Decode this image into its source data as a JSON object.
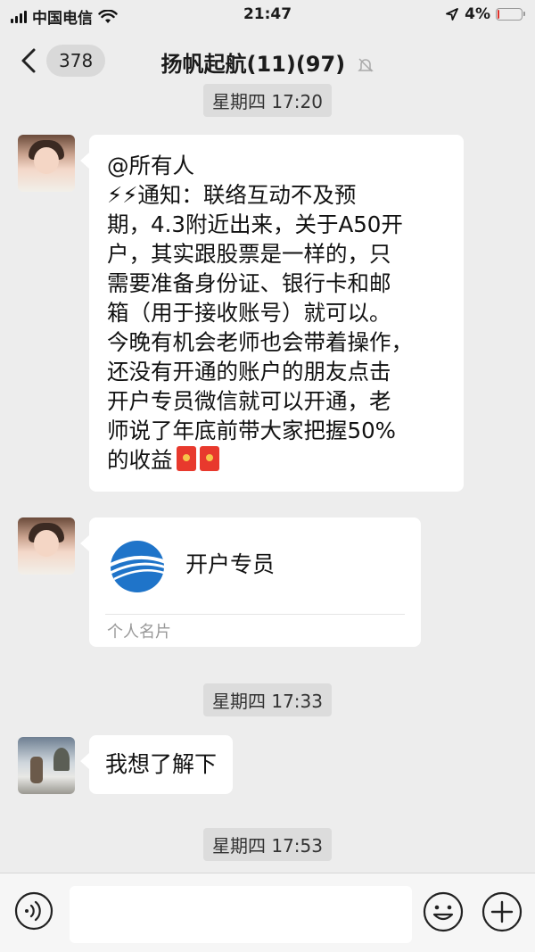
{
  "status_bar": {
    "carrier": "中国电信",
    "time": "21:47",
    "battery": "4%"
  },
  "nav": {
    "unread_count": "378",
    "title": "扬帆起航(11)(97)"
  },
  "chat": {
    "timestamps": [
      "星期四 17:20",
      "星期四 17:33",
      "星期四 17:53"
    ],
    "message1": {
      "lines": [
        "@所有人",
        "⚡⚡通知：联络互动不及预",
        "期，4.3附近出来，关于A50开",
        "户，其实跟股票是一样的，只",
        "需要准备身份证、银行卡和邮",
        "箱（用于接收账号）就可以。",
        "今晚有机会老师也会带着操作，",
        "还没有开通的账户的朋友点击",
        "开户专员微信就可以开通，老",
        "师说了年底前带大家把握50%",
        "的收益"
      ]
    },
    "contact_card": {
      "name": "开户专员",
      "label": "个人名片"
    },
    "message3": "我想了解下"
  },
  "input_bar": {
    "text_value": ""
  }
}
